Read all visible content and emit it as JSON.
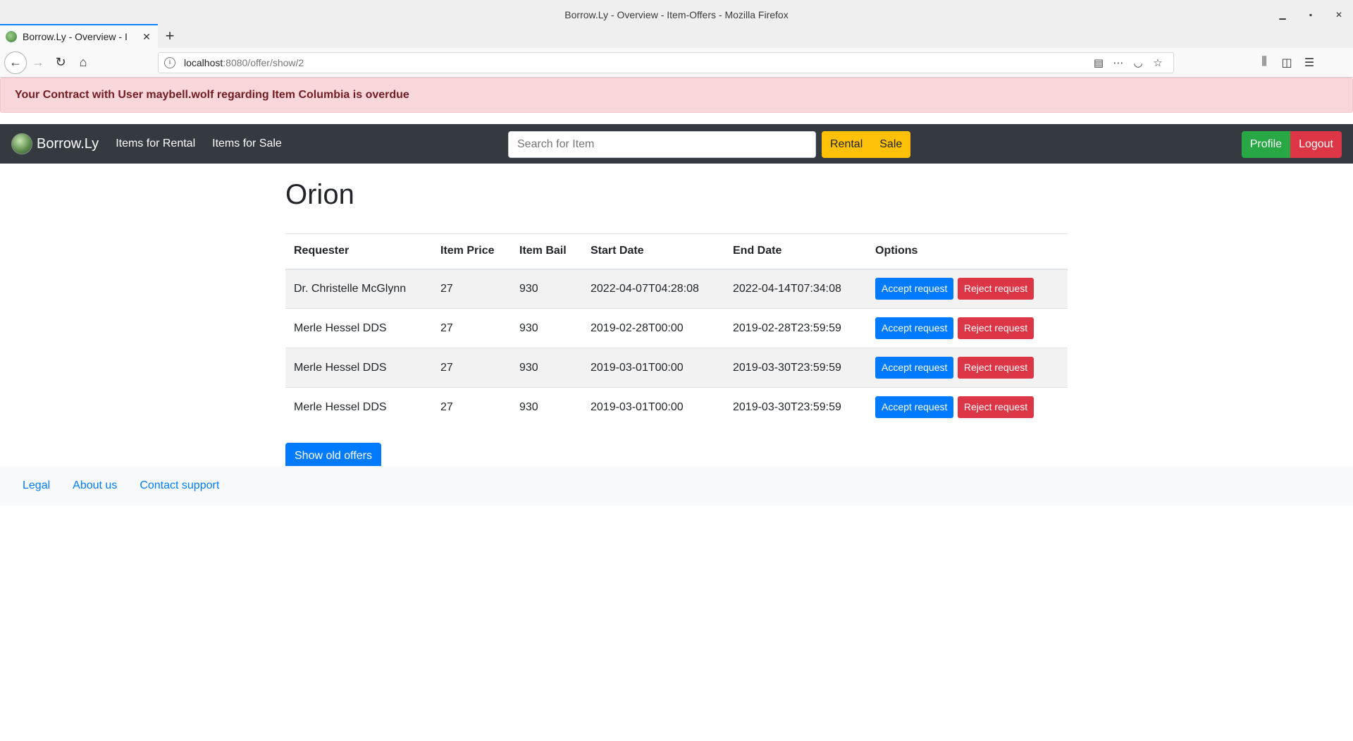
{
  "browser": {
    "window_title": "Borrow.Ly - Overview - Item-Offers - Mozilla Firefox",
    "tab_title": "Borrow.Ly - Overview - I",
    "url_host": "localhost",
    "url_path": ":8080/offer/show/2"
  },
  "alert": {
    "message": "Your Contract with User maybell.wolf regarding Item Columbia is overdue"
  },
  "nav": {
    "brand": "Borrow.Ly",
    "links": [
      "Items for Rental",
      "Items for Sale"
    ],
    "search_placeholder": "Search for Item",
    "rental_label": "Rental",
    "sale_label": "Sale",
    "profile_label": "Profile",
    "logout_label": "Logout"
  },
  "page": {
    "title": "Orion",
    "columns": [
      "Requester",
      "Item Price",
      "Item Bail",
      "Start Date",
      "End Date",
      "Options"
    ],
    "rows": [
      {
        "requester": "Dr. Christelle McGlynn",
        "price": "27",
        "bail": "930",
        "start": "2022-04-07T04:28:08",
        "end": "2022-04-14T07:34:08"
      },
      {
        "requester": "Merle Hessel DDS",
        "price": "27",
        "bail": "930",
        "start": "2019-02-28T00:00",
        "end": "2019-02-28T23:59:59"
      },
      {
        "requester": "Merle Hessel DDS",
        "price": "27",
        "bail": "930",
        "start": "2019-03-01T00:00",
        "end": "2019-03-30T23:59:59"
      },
      {
        "requester": "Merle Hessel DDS",
        "price": "27",
        "bail": "930",
        "start": "2019-03-01T00:00",
        "end": "2019-03-30T23:59:59"
      }
    ],
    "accept_label": "Accept request",
    "reject_label": "Reject request",
    "show_old_label": "Show old offers"
  },
  "footer": {
    "links": [
      "Legal",
      "About us",
      "Contact support"
    ]
  },
  "colors": {
    "primary": "#007bff",
    "danger": "#dc3545",
    "success": "#28a745",
    "warning": "#ffc107",
    "navbar": "#343a40",
    "alert_bg": "#f8d7da"
  }
}
